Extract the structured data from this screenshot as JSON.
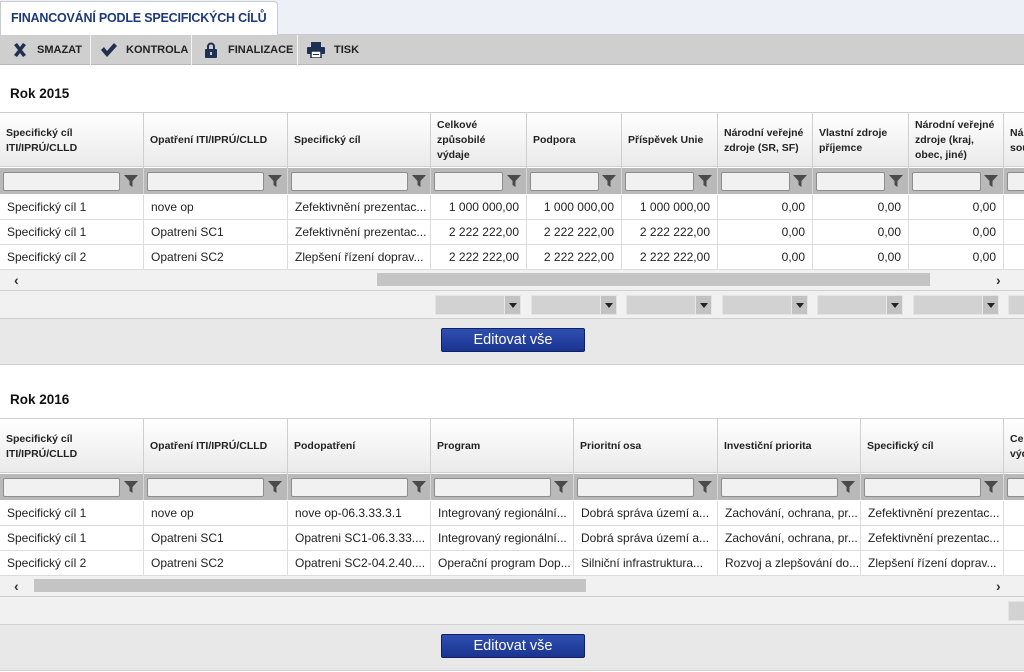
{
  "tab": {
    "title": "FINANCOVÁNÍ PODLE SPECIFICKÝCH CÍLŮ"
  },
  "toolbar": {
    "smazat": "SMAZAT",
    "kontrola": "KONTROLA",
    "finalizace": "FINALIZACE",
    "tisk": "TISK"
  },
  "section2015": {
    "year": "Rok 2015",
    "headers": [
      "Specifický cíl ITI/IPRÚ/CLLD",
      "Opatření ITI/IPRÚ/CLLD",
      "Specifický cíl",
      "Celkové způsobilé výdaje",
      "Podpora",
      "Příspěvek Unie",
      "Národní veřejné zdroje (SR, SF)",
      "Vlastní zdroje příjemce",
      "Národní veřejné zdroje (kraj, obec, jiné)",
      "Ná sou"
    ],
    "rows": [
      [
        "Specifický cíl 1",
        "nove op",
        "Zefektivnění prezentac...",
        "1 000 000,00",
        "1 000 000,00",
        "1 000 000,00",
        "0,00",
        "0,00",
        "0,00"
      ],
      [
        "Specifický cíl 1",
        "Opatreni SC1",
        "Zefektivnění prezentac...",
        "2 222 222,00",
        "2 222 222,00",
        "2 222 222,00",
        "0,00",
        "0,00",
        "0,00"
      ],
      [
        "Specifický cíl 2",
        "Opatreni SC2",
        "Zlepšení řízení doprav...",
        "2 222 222,00",
        "2 222 222,00",
        "2 222 222,00",
        "0,00",
        "0,00",
        "0,00"
      ]
    ],
    "edit_label": "Editovat vše"
  },
  "section2016": {
    "year": "Rok 2016",
    "headers": [
      "Specifický cíl ITI/IPRÚ/CLLD",
      "Opatření ITI/IPRÚ/CLLD",
      "Podopatření",
      "Program",
      "Prioritní osa",
      "Investiční priorita",
      "Specifický cíl",
      "Cel výd"
    ],
    "rows": [
      [
        "Specifický cíl 1",
        "nove op",
        "nove op-06.3.33.3.1",
        "Integrovaný regionální...",
        "Dobrá správa území a...",
        "Zachování, ochrana, pr...",
        "Zefektivnění prezentac..."
      ],
      [
        "Specifický cíl 1",
        "Opatreni SC1",
        "Opatreni SC1-06.3.33....",
        "Integrovaný regionální...",
        "Dobrá správa území a...",
        "Zachování, ochrana, pr...",
        "Zefektivnění prezentac..."
      ],
      [
        "Specifický cíl 2",
        "Opatreni SC2",
        "Opatreni SC2-04.2.40....",
        "Operační program Dop...",
        "Silniční infrastruktura...",
        "Rozvoj a zlepšování do...",
        "Zlepšení řízení doprav..."
      ]
    ],
    "edit_label": "Editovat vše"
  },
  "colors": {
    "accent": "#1c3a7a",
    "button": "#2a46a6",
    "toolbar": "#cfcfcf",
    "filter_row": "#b9b9b9"
  }
}
